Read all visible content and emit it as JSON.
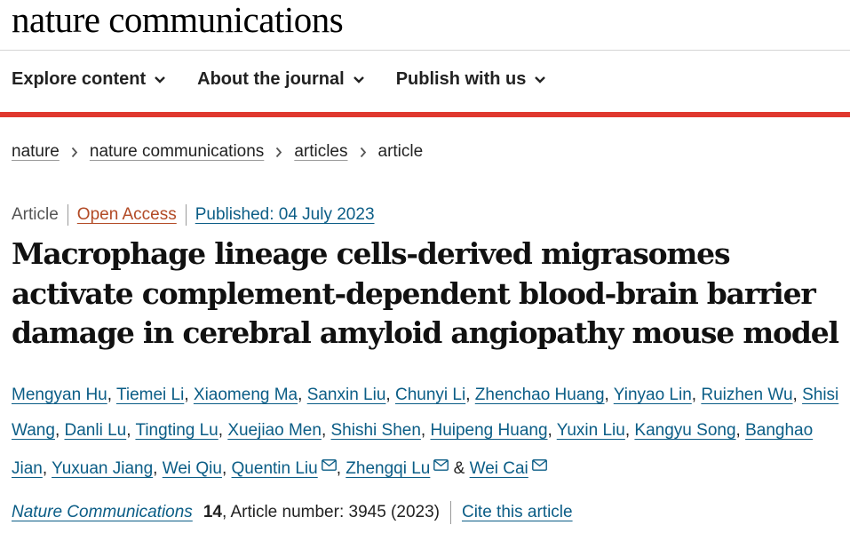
{
  "site": {
    "brand": "nature communications"
  },
  "nav": {
    "items": [
      {
        "label": "Explore content"
      },
      {
        "label": "About the journal"
      },
      {
        "label": "Publish with us"
      }
    ]
  },
  "breadcrumb": {
    "items": [
      "nature",
      "nature communications",
      "articles"
    ],
    "current": "article"
  },
  "meta": {
    "type": "Article",
    "access": "Open Access",
    "published": "Published: 04 July 2023"
  },
  "article": {
    "title": "Macrophage lineage cells-derived migrasomes activate complement-dependent blood-brain barrier damage in cerebral amyloid angiopathy mouse model"
  },
  "authors": [
    {
      "name": "Mengyan Hu",
      "corresponding": false
    },
    {
      "name": "Tiemei Li",
      "corresponding": false
    },
    {
      "name": "Xiaomeng Ma",
      "corresponding": false
    },
    {
      "name": "Sanxin Liu",
      "corresponding": false
    },
    {
      "name": "Chunyi Li",
      "corresponding": false
    },
    {
      "name": "Zhenchao Huang",
      "corresponding": false
    },
    {
      "name": "Yinyao Lin",
      "corresponding": false
    },
    {
      "name": "Ruizhen Wu",
      "corresponding": false
    },
    {
      "name": "Shisi Wang",
      "corresponding": false
    },
    {
      "name": "Danli Lu",
      "corresponding": false
    },
    {
      "name": "Tingting Lu",
      "corresponding": false
    },
    {
      "name": "Xuejiao Men",
      "corresponding": false
    },
    {
      "name": "Shishi Shen",
      "corresponding": false
    },
    {
      "name": "Huipeng Huang",
      "corresponding": false
    },
    {
      "name": "Yuxin Liu",
      "corresponding": false
    },
    {
      "name": "Kangyu Song",
      "corresponding": false
    },
    {
      "name": "Banghao Jian",
      "corresponding": false
    },
    {
      "name": "Yuxuan Jiang",
      "corresponding": false
    },
    {
      "name": "Wei Qiu",
      "corresponding": false
    },
    {
      "name": "Quentin Liu",
      "corresponding": true
    },
    {
      "name": "Zhengqi Lu",
      "corresponding": true
    },
    {
      "name": "Wei Cai",
      "corresponding": true
    }
  ],
  "author_separators": {
    "comma": ",",
    "ampersand": "&"
  },
  "citation": {
    "journal": "Nature Communications",
    "volume": "14",
    "rest": ", Article number: 3945 (2023)",
    "cite_label": "Cite this article"
  },
  "icons": {
    "nav_dropdown": "chevron-down-icon",
    "breadcrumb": "chevron-right-icon",
    "author_email": "envelope-icon"
  },
  "colors": {
    "accent_red": "#e0382e",
    "link_blue": "#0b5d86",
    "open_access": "#b24a25"
  }
}
